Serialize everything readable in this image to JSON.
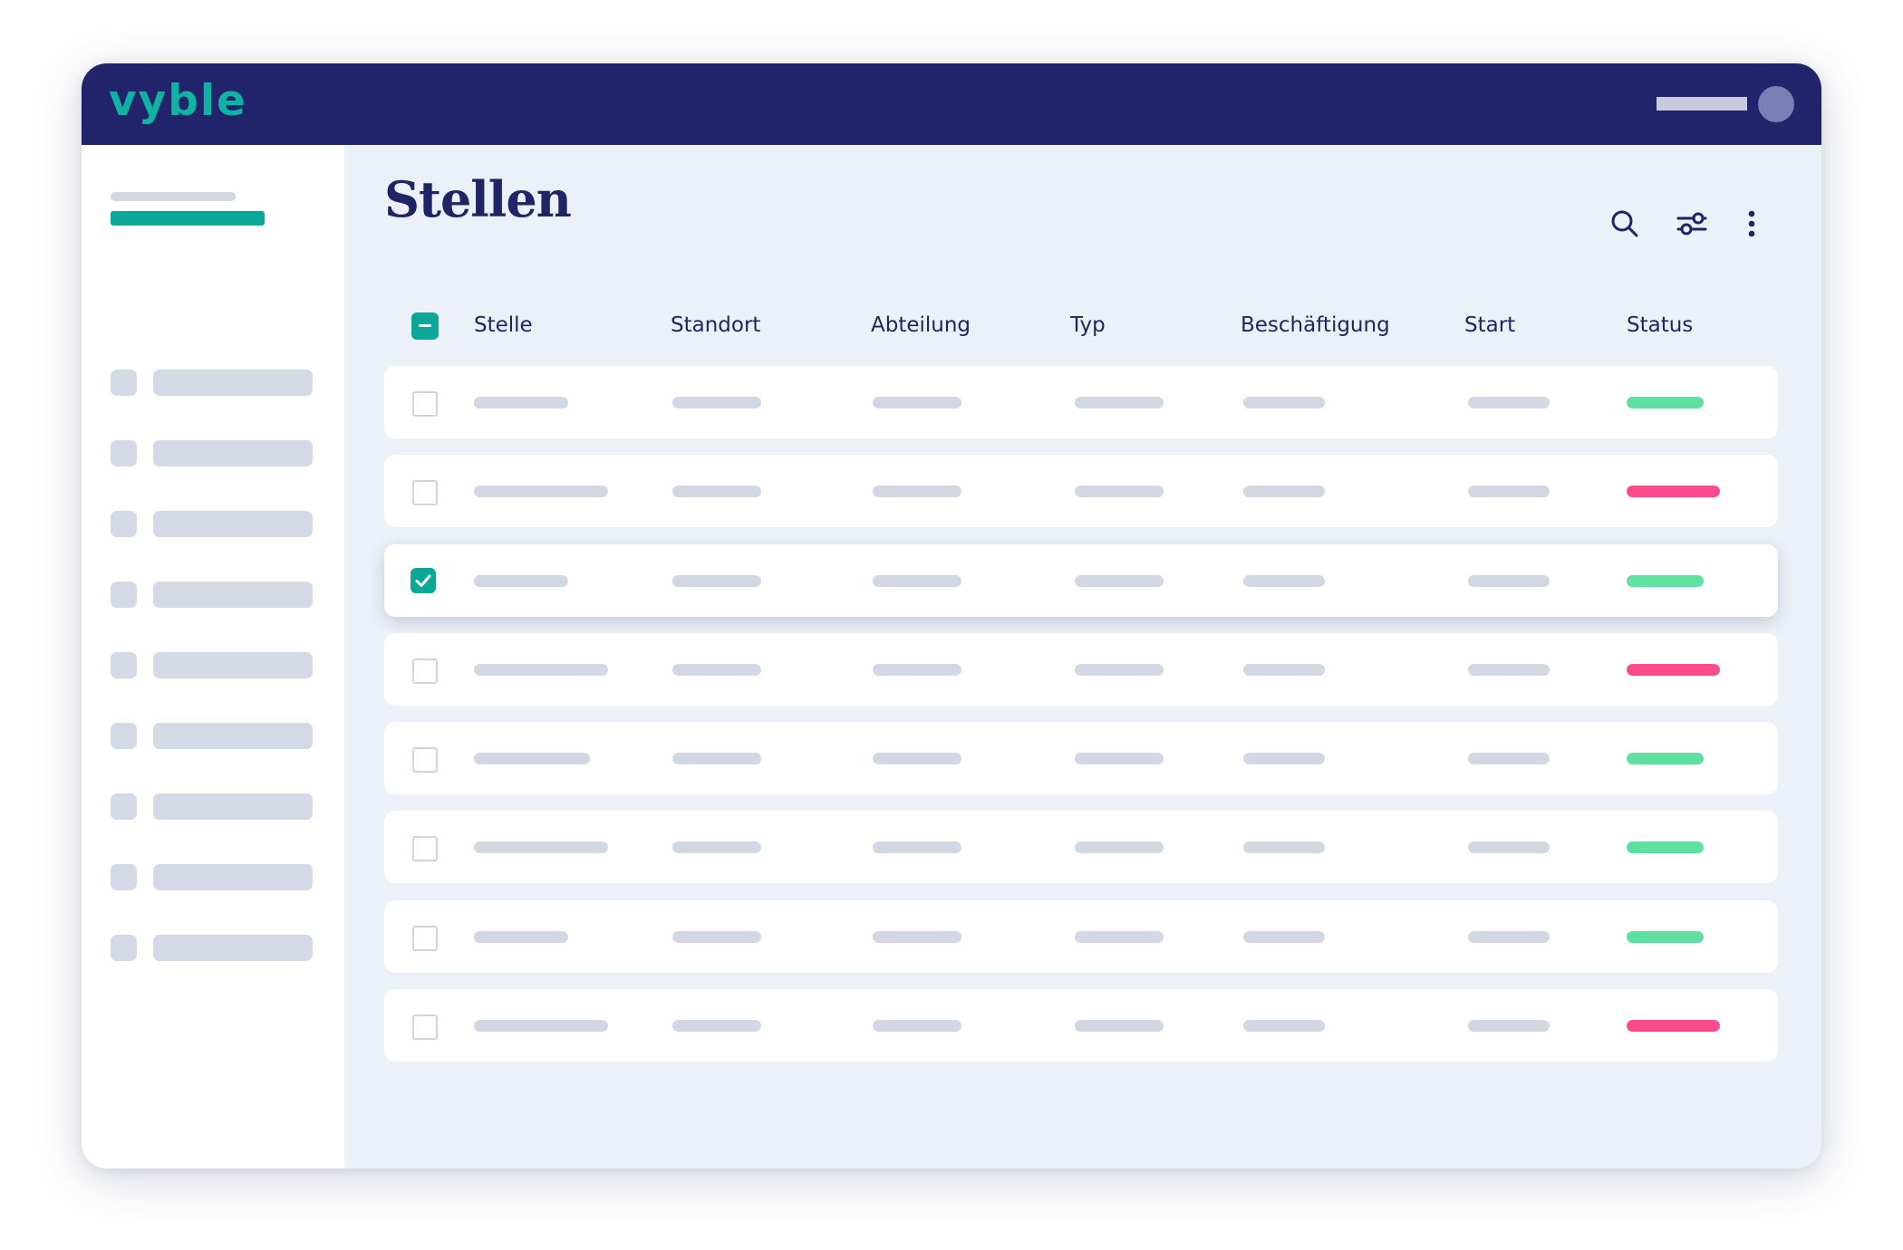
{
  "app": {
    "logo_text": "vyble"
  },
  "page": {
    "title": "Stellen"
  },
  "colors": {
    "topbar": "#22246b",
    "accent": "#0ba89a",
    "status_active": "#5fe0a1",
    "status_inactive": "#fb4b8f"
  },
  "toolbar": {
    "search_icon": "search-icon",
    "filter_icon": "filter-sliders-icon",
    "more_icon": "more-vertical-icon"
  },
  "table": {
    "columns": [
      "Stelle",
      "Standort",
      "Abteilung",
      "Typ",
      "Beschäftigung",
      "Start",
      "Status"
    ],
    "header_checkbox": "indeterminate",
    "rows": [
      {
        "checked": false,
        "status": "active"
      },
      {
        "checked": false,
        "status": "inactive"
      },
      {
        "checked": true,
        "status": "active"
      },
      {
        "checked": false,
        "status": "inactive"
      },
      {
        "checked": false,
        "status": "active"
      },
      {
        "checked": false,
        "status": "active"
      },
      {
        "checked": false,
        "status": "active"
      },
      {
        "checked": false,
        "status": "inactive"
      }
    ]
  }
}
